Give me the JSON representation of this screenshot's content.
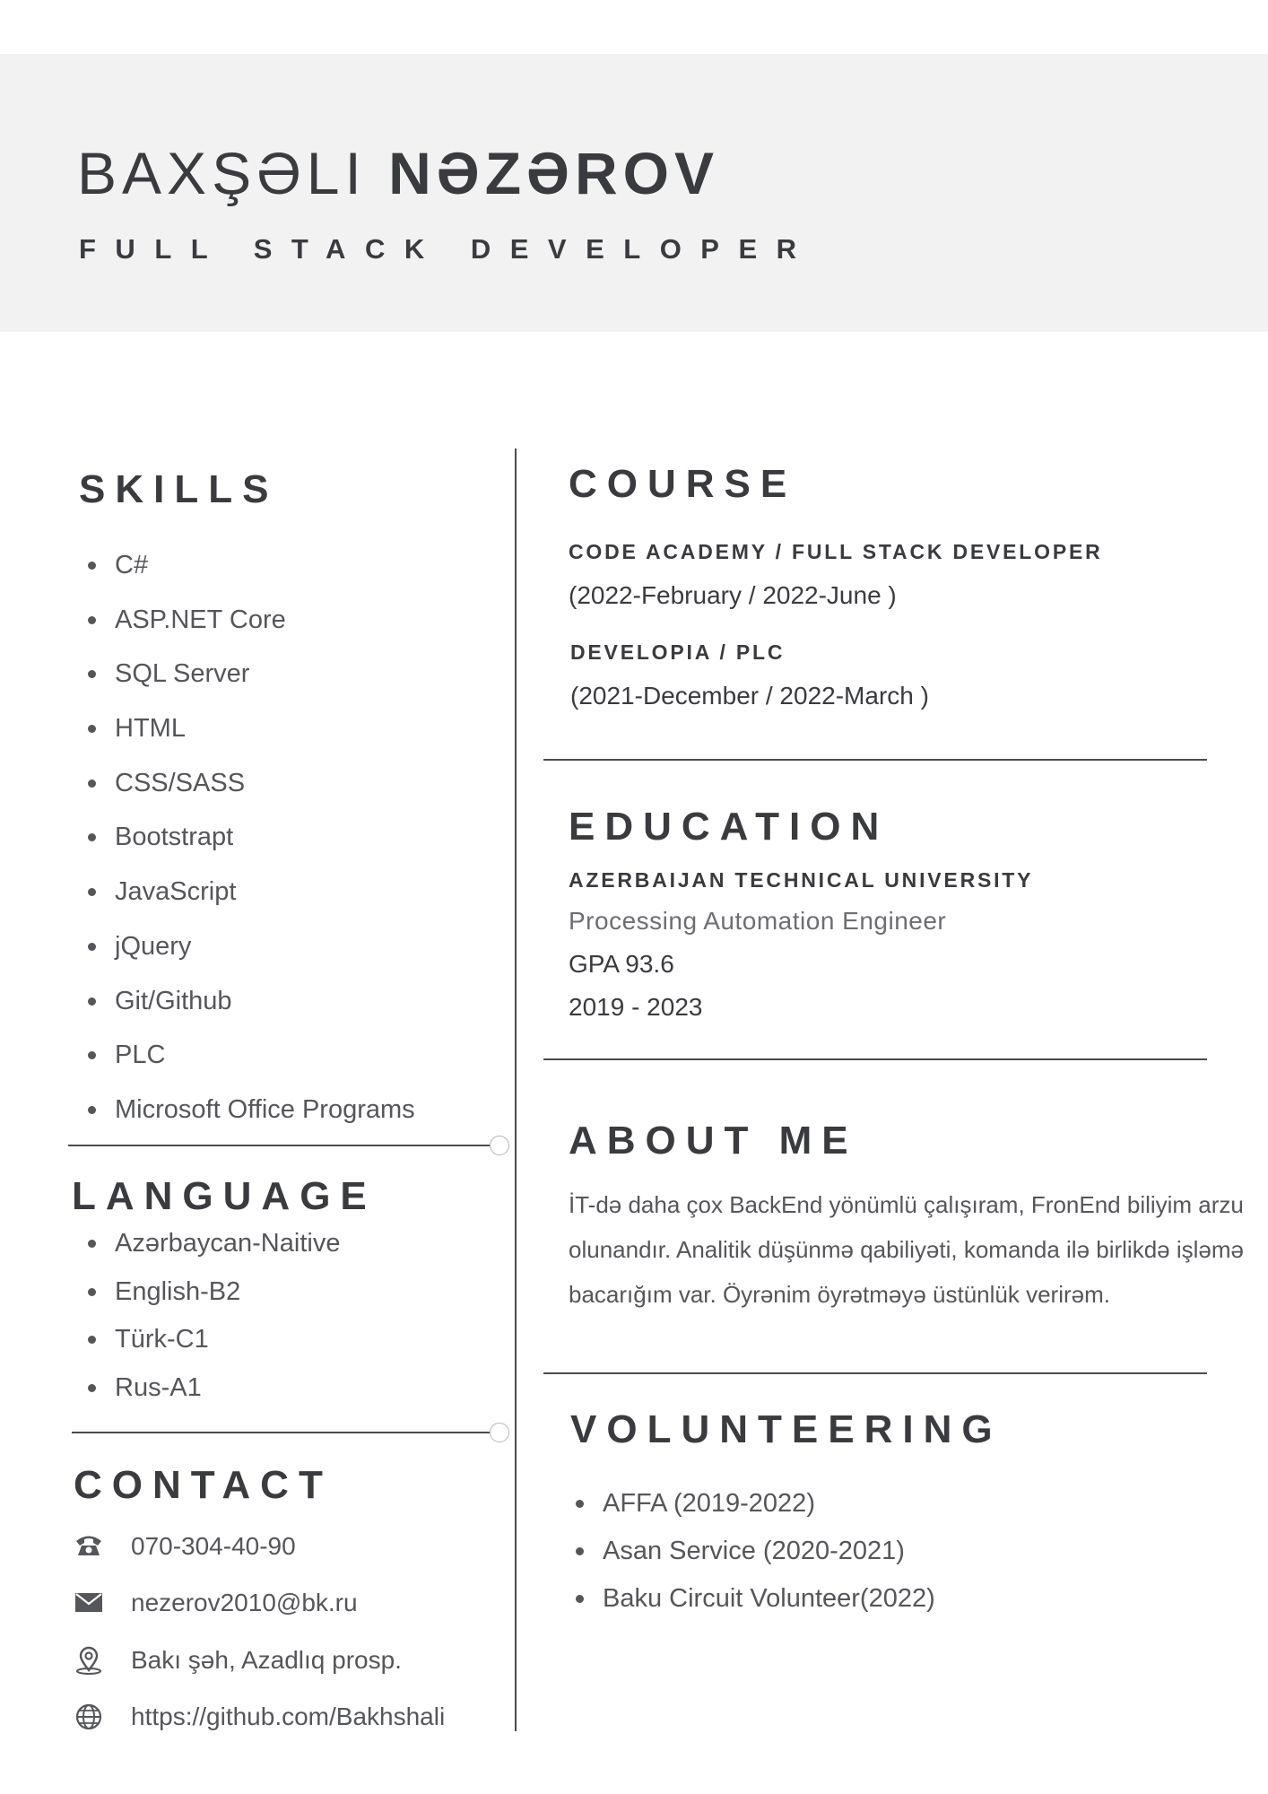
{
  "header": {
    "first_name": "BAXŞƏLI",
    "last_name": "NƏZƏROV",
    "job_title": "FULL STACK DEVELOPER"
  },
  "skills": {
    "title": "SKILLS",
    "items": [
      "C#",
      "ASP.NET Core",
      "SQL Server",
      "HTML",
      "CSS/SASS",
      "Bootstrapt",
      "JavaScript",
      "jQuery",
      "Git/Github",
      "PLC",
      "Microsoft Office Programs"
    ]
  },
  "language": {
    "title": "LANGUAGE",
    "items": [
      "Azərbaycan-Naitive",
      "English-B2",
      "Türk-C1",
      "Rus-A1"
    ]
  },
  "contact": {
    "title": "CONTACT",
    "phone": "070-304-40-90",
    "email": "nezerov2010@bk.ru",
    "address": "Bakı şəh, Azadlıq prosp.",
    "website": "https://github.com/Bakhshali",
    "icons": [
      "phone-icon",
      "mail-icon",
      "location-pin-icon",
      "globe-icon"
    ]
  },
  "course": {
    "title": "COURSE",
    "entries": [
      {
        "org": "CODE ACADEMY / FULL STACK DEVELOPER",
        "dates": "(2022-February / 2022-June )"
      },
      {
        "org": "DEVELOPIA / PLC",
        "dates": "(2021-December / 2022-March )"
      }
    ]
  },
  "education": {
    "title": "EDUCATION",
    "school": "AZERBAIJAN TECHNICAL UNIVERSITY",
    "degree": "Processing Automation Engineer",
    "gpa": "GPA 93.6",
    "years": "2019 - 2023"
  },
  "about": {
    "title": "ABOUT ME",
    "text": "İT-də daha çox BackEnd yönümlü çalışıram, FronEnd biliyim arzu olunandır. Analitik düşünmə qabiliyəti, komanda ilə birlikdə işləmə bacarığım var. Öyrənim öyrətməyə üstünlük verirəm."
  },
  "volunteering": {
    "title": "VOLUNTEERING",
    "items": [
      "AFFA (2019-2022)",
      "Asan Service (2020-2021)",
      "Baku Circuit Volunteer(2022)"
    ]
  },
  "colors": {
    "header_band": "#f2f2f2",
    "heading_text": "#3a3b3f",
    "body_text": "#55565a",
    "muted_text": "#6d6e72"
  }
}
